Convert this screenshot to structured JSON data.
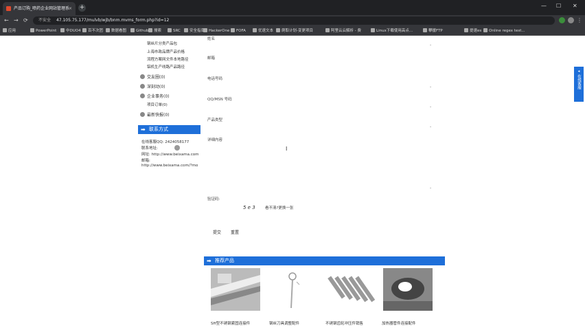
{
  "browser": {
    "tab_title": "产品订购_喷药企业网站管理系",
    "tab_close": "×",
    "new_tab": "+",
    "win_min": "—",
    "win_max": "☐",
    "win_close": "✕",
    "not_secure": "不安全",
    "url": "47.105.75.177/mulvb/wjb/bnm.mvms_form.php?id=12",
    "bookmarks": [
      "应用",
      "PowerPoint",
      "中DUO4",
      "百不次团",
      "数据看图",
      "Github",
      "搜索",
      "SRC",
      "安全指南",
      "HackerOne",
      "FOFA",
      "优速文本",
      "爬取计划-变更项目",
      "阿里云云解析 - 费",
      "Linux下载使用高点...",
      "攀援FTP",
      "提速es",
      "Online regex test..."
    ]
  },
  "sidebar": {
    "links": [
      "钢丝片分类产品包",
      "上海市政品牌产品价格",
      "流程方案网文件本地路径",
      "铝机生产线路产品路径"
    ],
    "categories": [
      {
        "label": "交友圈(0)"
      },
      {
        "label": "深刻动(0)"
      },
      {
        "label": "企业事务(0)",
        "sub": "项目订单(0)"
      },
      {
        "label": "最新快报(0)"
      }
    ],
    "contact_title": "联系方式",
    "contact_lines": [
      "在线客服QQ: 2424058177",
      "联系地址:",
      "网址: http://www.beixama.com",
      "邮箱:",
      "http://www.beixama.com/?mo"
    ]
  },
  "form": {
    "labels": [
      "姓名",
      "邮箱",
      "电话号码",
      "QQ/MSN 号码",
      "产品类型",
      "详细内容",
      "验证码:"
    ],
    "captcha_code": "5 e 3",
    "captcha_refresh": "看不清?更换一张",
    "submit": "提交",
    "reset": "重置",
    "cursor": "I"
  },
  "products": {
    "title": "推荐产品",
    "items": [
      "SH型不锈钢紧固连接件",
      "钢丝刀具调整配件",
      "不锈钢齿轮冲压件销售",
      "加热器管件连接配件"
    ]
  },
  "float_tab": {
    "label": "在线客服"
  }
}
